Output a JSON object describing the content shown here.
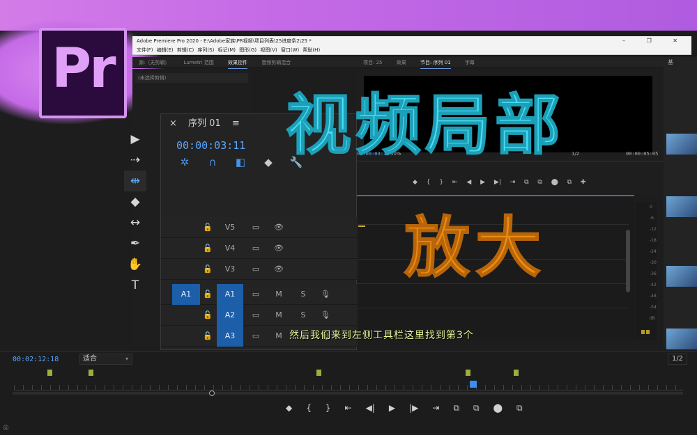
{
  "window": {
    "title": "Adobe Premiere Pro 2020 - E:\\Adobe家族\\PR视频\\项目列表\\25进度条2\\25 *",
    "controls": "– ❐ ✕"
  },
  "menu": {
    "items": "文件(F) 编辑(E) 剪辑(C) 序列(S) 标记(M) 图形(G) 视图(V) 窗口(W) 帮助(H)"
  },
  "logo": {
    "text": "Pr"
  },
  "left_panel": {
    "tabs": [
      "源:（无剪辑）",
      "Lumetri 范围",
      "效果控件",
      "音频剪辑混合"
    ],
    "row1": "(未选择剪辑)"
  },
  "right_panel": {
    "tabs": [
      "项目: 25",
      "效果",
      "节目: 序列 01",
      "字幕"
    ],
    "timecode_left": "00:00:03:11",
    "zoom": "50%",
    "fraction": "1/2",
    "timecode_right": "00:00:05:05",
    "controls": "◆ { } ⇤ ◀ ▶ ▶| ⇥ ⧉ ⧉ ⬤ ⧉ ✚",
    "side_tab": "基"
  },
  "tools": [
    "▶",
    "⇢",
    "⇹",
    "◆",
    "↔",
    "✒",
    "✋",
    "T"
  ],
  "sequence": {
    "close": "×",
    "title": "序列 01",
    "menu": "≡",
    "timecode": "00:00:03:11",
    "icons": [
      "✲",
      "∩",
      "◧",
      "◆",
      "🔧"
    ],
    "tracks": [
      {
        "source": "",
        "lock": "🔓",
        "name": "V5",
        "sync": "▭",
        "toggle": "👁"
      },
      {
        "source": "",
        "lock": "🔓",
        "name": "V4",
        "sync": "▭",
        "toggle": "👁"
      },
      {
        "source": "",
        "lock": "🔓",
        "name": "V3",
        "sync": "▭",
        "toggle": "👁"
      },
      {
        "source": "A1",
        "lock": "🔓",
        "name": "A1",
        "sync": "▭",
        "toggle": "M",
        "solo": "S",
        "mic": "🎙"
      },
      {
        "source": "",
        "lock": "🔓",
        "name": "A2",
        "sync": "▭",
        "toggle": "M",
        "solo": "S",
        "mic": "🎙"
      },
      {
        "source": "",
        "lock": "🔓",
        "name": "A3",
        "sync": "▭",
        "toggle": "M",
        "solo": "S",
        "mic": "🎙"
      }
    ]
  },
  "overlay": {
    "title_line1": "视频局部",
    "title_line2": "放大",
    "subtitle": "然后我们来到左侧工具栏这里找到第3个"
  },
  "meter": {
    "scale": [
      "0",
      "-6",
      "-12",
      "-18",
      "-24",
      "-30",
      "-36",
      "-42",
      "-48",
      "-54",
      "dB"
    ]
  },
  "bottom": {
    "timecode": "00:02:12:18",
    "fit": "适合",
    "fraction": "1/2",
    "controls": [
      "◆",
      "{",
      "}",
      "⇤",
      "◀|",
      "▶",
      "|▶",
      "⇥",
      "⧉",
      "⧉",
      "⬤",
      "⧉"
    ],
    "corner": "◎"
  },
  "colors": {
    "accent_blue": "#5aa6ff",
    "title_cyan": "#4ae1f4",
    "title_orange": "#ec8d12",
    "subtitle_yellow": "#e8f39a"
  }
}
